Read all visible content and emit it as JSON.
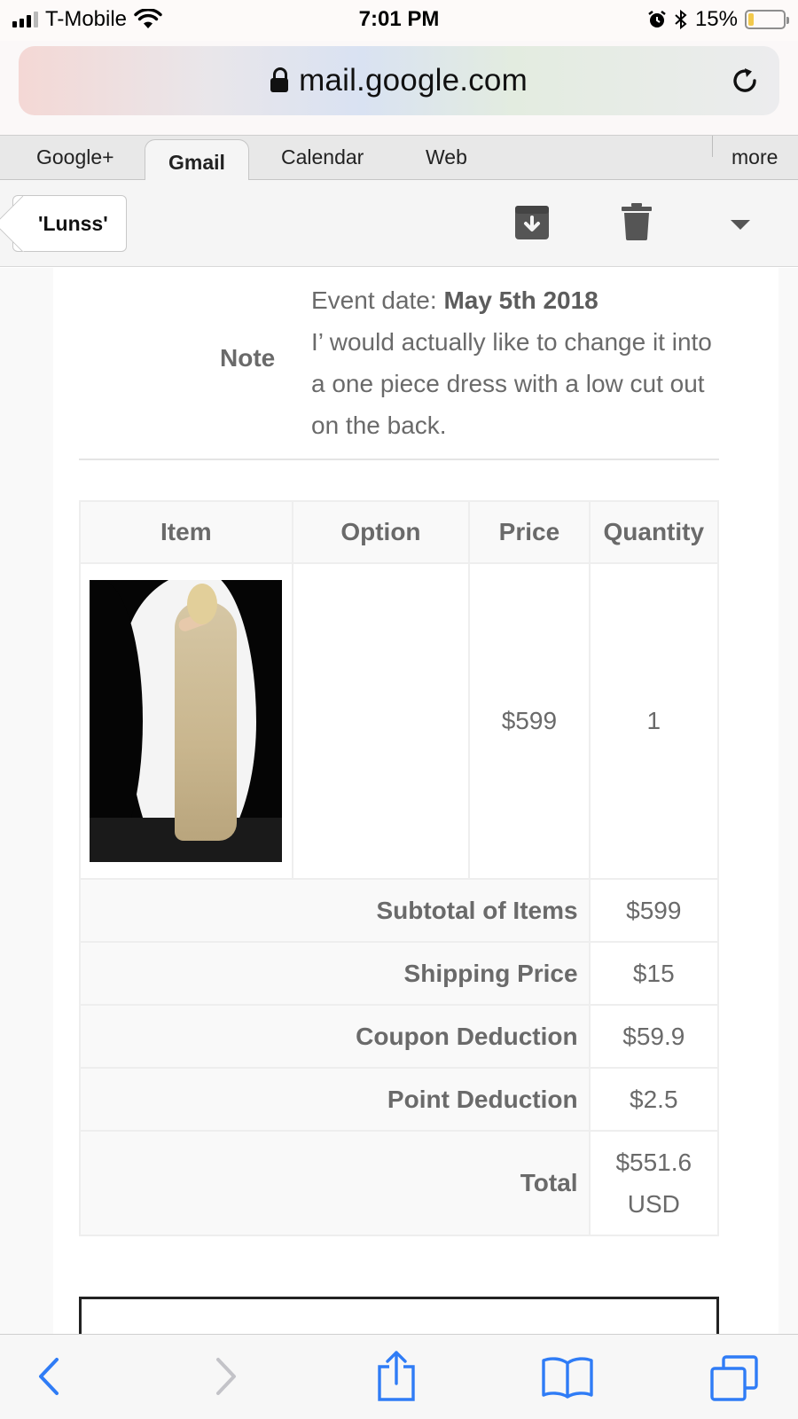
{
  "status_bar": {
    "carrier": "T-Mobile",
    "time": "7:01 PM",
    "battery_percent": "15%",
    "battery_level": 0.15,
    "icons": [
      "signal-icon",
      "wifi-icon",
      "alarm-icon",
      "bluetooth-icon",
      "battery-icon"
    ]
  },
  "browser": {
    "url": "mail.google.com",
    "icons": [
      "lock-icon",
      "reload-icon"
    ]
  },
  "google_tabs": {
    "items": [
      {
        "label": "Google+"
      },
      {
        "label": "Gmail",
        "active": true
      },
      {
        "label": "Calendar"
      },
      {
        "label": "Web"
      },
      {
        "label": "more"
      }
    ]
  },
  "toolbar": {
    "back_label": "'Lunss'",
    "icons": [
      "archive-icon",
      "trash-icon",
      "caret-down-icon"
    ]
  },
  "note": {
    "label": "Note",
    "event_prefix": "Event date: ",
    "event_date": "May 5th 2018",
    "text": "I’ would actually like to change it into a one piece dress with a low cut out on the back."
  },
  "order_table": {
    "headers": [
      "Item",
      "Option",
      "Price",
      "Quantity"
    ],
    "row": {
      "option": "",
      "price": "$599",
      "quantity": "1"
    },
    "summary": [
      {
        "label": "Subtotal of Items",
        "value": "$599"
      },
      {
        "label": "Shipping Price",
        "value": "$15"
      },
      {
        "label": "Coupon Deduction",
        "value": "$59.9"
      },
      {
        "label": "Point Deduction",
        "value": "$2.5"
      }
    ],
    "total": {
      "label": "Total",
      "value_line1": "$551.6",
      "value_line2": "USD"
    }
  },
  "safari_toolbar": {
    "icons": [
      "back-arrow-icon",
      "forward-arrow-icon",
      "share-icon",
      "bookmarks-icon",
      "tabs-icon"
    ]
  },
  "colors": {
    "ios_blue": "#2f7cf6",
    "text_gray": "#6a6a6a"
  }
}
